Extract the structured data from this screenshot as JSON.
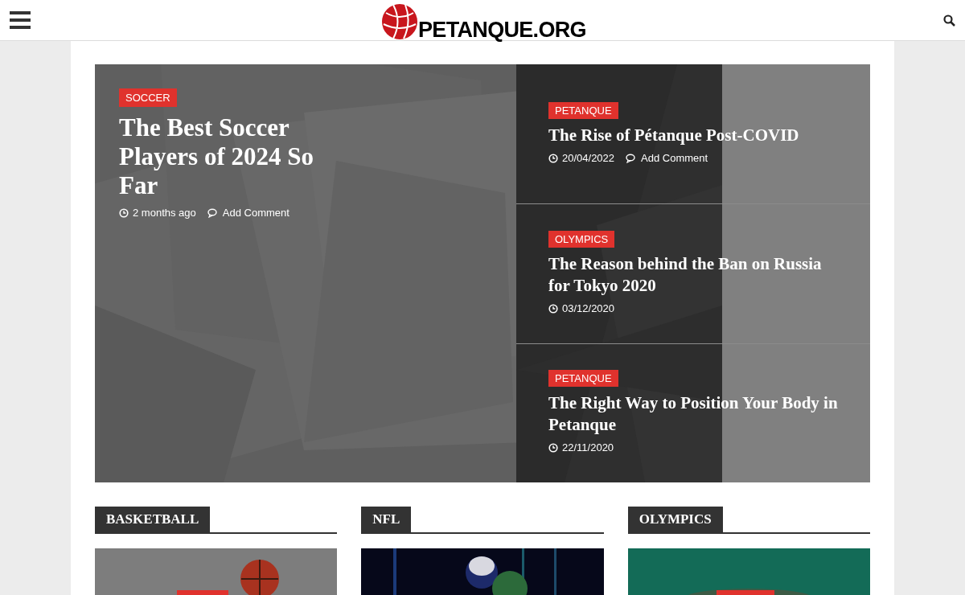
{
  "header": {
    "logo_text": "PETANQUE.ORG"
  },
  "featured": {
    "category": "SOCCER",
    "title": "The Best Soccer Players of 2024 So Far",
    "date": "2 months ago",
    "comments": "Add Comment"
  },
  "side_posts": [
    {
      "category": "PETANQUE",
      "title": "The Rise of Pétanque Post-COVID",
      "date": "20/04/2022",
      "comments": "Add Comment"
    },
    {
      "category": "OLYMPICS",
      "title": "The Reason behind the Ban on Russia for Tokyo 2020",
      "date": "03/12/2020"
    },
    {
      "category": "PETANQUE",
      "title": "The Right Way to Position Your Body in Petanque",
      "date": "22/11/2020"
    }
  ],
  "sections": [
    {
      "title": "BASKETBALL"
    },
    {
      "title": "NFL"
    },
    {
      "title": "OLYMPICS"
    }
  ]
}
